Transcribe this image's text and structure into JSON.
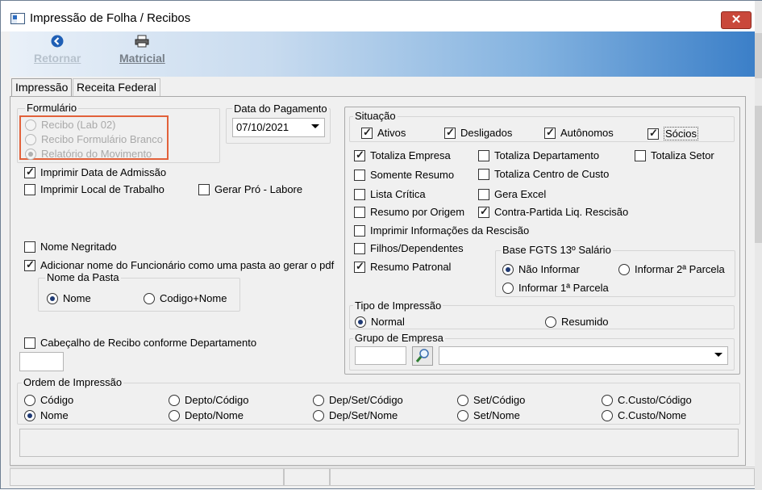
{
  "window": {
    "title": "Impressão de Folha / Recibos",
    "close_label": "✕"
  },
  "toolbar": {
    "retornar_label": "Retornar",
    "matricial_label": "Matricial"
  },
  "tabs": [
    {
      "label": "Impressão"
    },
    {
      "label": "Receita Federal"
    }
  ],
  "formulario": {
    "title": "Formulário",
    "options": [
      {
        "label": "Recibo (Lab 02)",
        "selected": false
      },
      {
        "label": "Recibo Formulário Branco",
        "selected": false
      },
      {
        "label": "Relatório do Movimento",
        "selected": true
      }
    ]
  },
  "pagamento": {
    "label": "Data do Pagamento",
    "value": "07/10/2021"
  },
  "left_options": {
    "imprimir_admissao": "Imprimir Data de Admissão",
    "imprimir_local": "Imprimir Local de Trabalho",
    "gerar_pro_labore": "Gerar Pró - Labore",
    "nome_negritado": "Nome Negritado",
    "adicionar_nome": "Adicionar nome do Funcionário como uma pasta ao gerar o pdf",
    "cabecalho": "Cabeçalho de Recibo conforme Departamento"
  },
  "nome_pasta": {
    "title": "Nome da Pasta",
    "opt_nome": "Nome",
    "opt_codigo_nome": "Codigo+Nome"
  },
  "situacao": {
    "title": "Situação",
    "ativos": "Ativos",
    "desligados": "Desligados",
    "autonomos": "Autônomos",
    "socios": "Sócios"
  },
  "options": {
    "totaliza_empresa": "Totaliza Empresa",
    "totaliza_departamento": "Totaliza Departamento",
    "totaliza_setor": "Totaliza Setor",
    "somente_resumo": "Somente Resumo",
    "totaliza_centro_custo": "Totaliza Centro de Custo",
    "lista_critica": "Lista Crítica",
    "gera_excel": "Gera Excel",
    "resumo_origem": "Resumo por Origem",
    "contra_partida": "Contra-Partida Liq. Rescisão",
    "imprimir_informacoes": "Imprimir Informações da Rescisão",
    "filhos_dependentes": "Filhos/Dependentes",
    "resumo_patronal": "Resumo Patronal"
  },
  "fgts": {
    "title": "Base FGTS 13º Salário",
    "nao_informar": "Não Informar",
    "segunda_parcela": "Informar 2ª Parcela",
    "primeira_parcela": "Informar 1ª Parcela"
  },
  "tipo_impressao": {
    "title": "Tipo de Impressão",
    "normal": "Normal",
    "resumido": "Resumido"
  },
  "grupo_empresa": {
    "title": "Grupo de Empresa"
  },
  "ordem": {
    "title": "Ordem de Impressão",
    "row1": [
      "Código",
      "Depto/Código",
      "Dep/Set/Código",
      "Set/Código",
      "C.Custo/Código"
    ],
    "row2": [
      "Nome",
      "Depto/Nome",
      "Dep/Set/Nome",
      "Set/Nome",
      "C.Custo/Nome"
    ]
  },
  "colors": {
    "highlight": "#e2613a",
    "toolbar_end": "#3b7fc8",
    "close": "#c9483b"
  }
}
